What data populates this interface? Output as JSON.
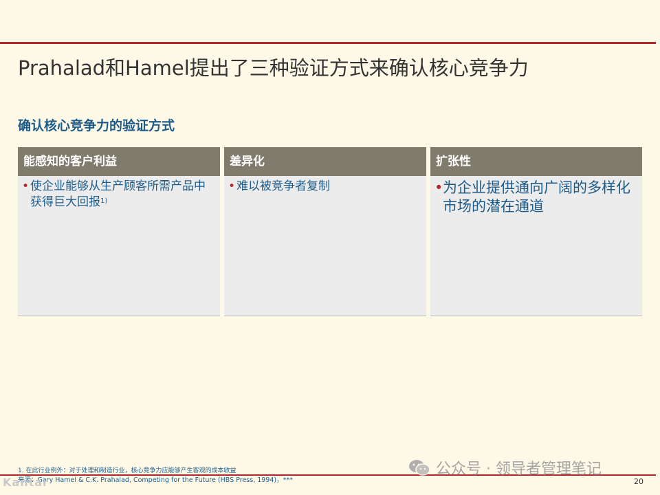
{
  "title": "Prahalad和Hamel提出了三种验证方式来确认核心竞争力",
  "subtitle": "确认核心竞争力的验证方式",
  "columns": [
    {
      "header": "能感知的客户利益",
      "bullet": "使企业能够从生产顾客所需产品中获得巨大回报",
      "sup": "1)"
    },
    {
      "header": "差异化",
      "bullet": "难以被竞争者复制",
      "sup": ""
    },
    {
      "header": "扩张性",
      "bullet": "为企业提供通向广阔的多样化市场的潜在通道",
      "sup": ""
    }
  ],
  "bullet_glyph": "•",
  "footnote": "1. 在此行业例外：对于处理和制造行业，核心竞争力应能够产生客观的成本收益",
  "source": "来源：Gary Hamel & C.K. Prahalad, Competing for the Future (HBS Press, 1994)，***",
  "watermark": "公众号 · 领导者管理笔记",
  "logo_text": "Kantar",
  "page_number": "20",
  "colors": {
    "accent_red": "#b3262b",
    "header_gray": "#7f7b6d",
    "text_blue": "#1d5c8a",
    "background": "#fdf9e6"
  }
}
